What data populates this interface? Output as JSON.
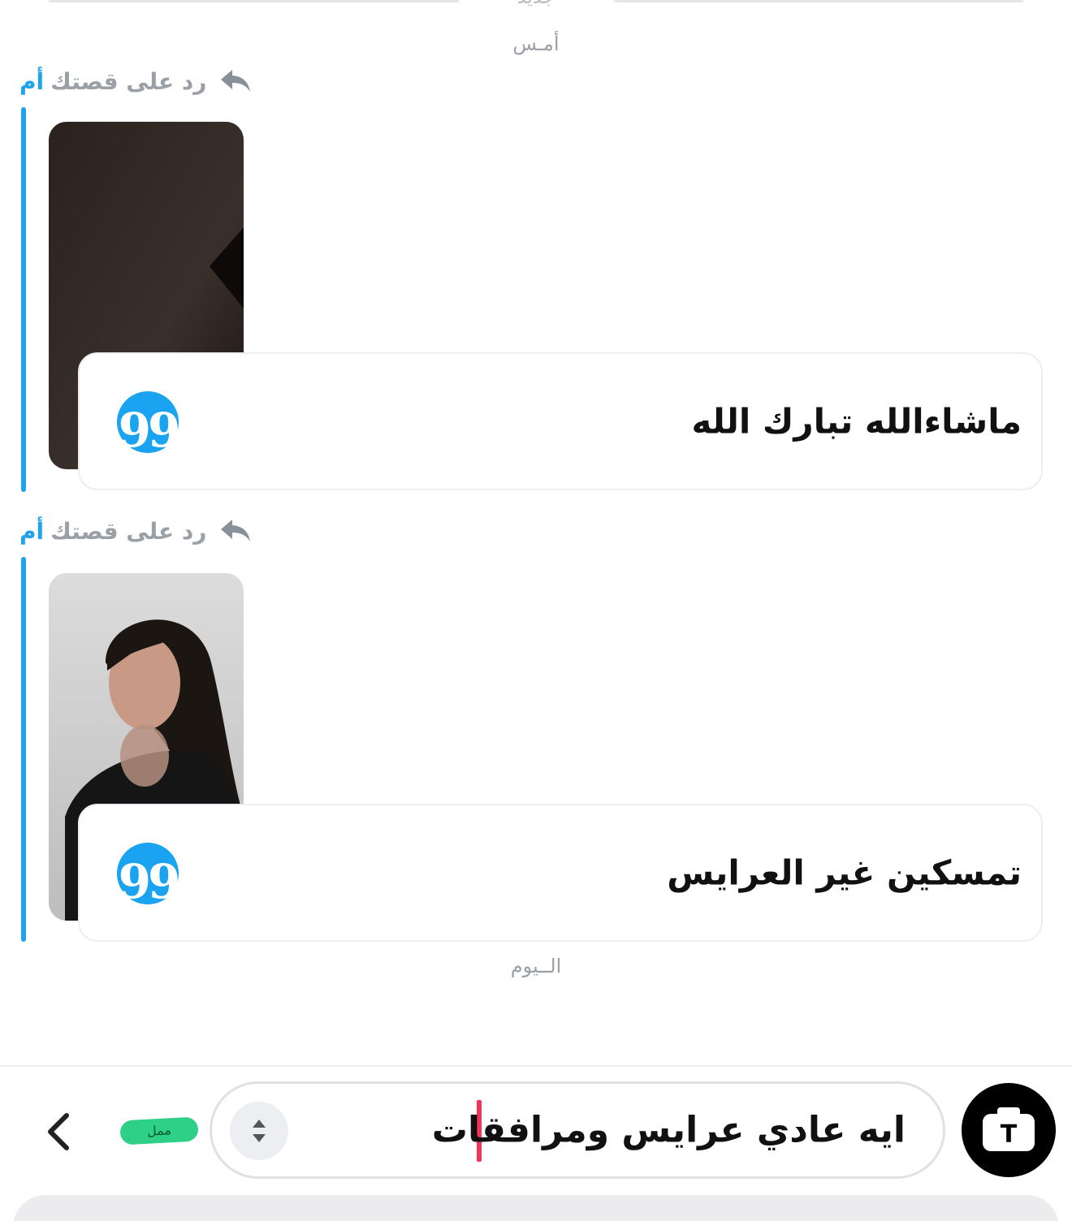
{
  "dividers": {
    "top_label": "جديد",
    "yesterday": "أمـس",
    "today": "الــيوم"
  },
  "messages": [
    {
      "reply_who": "أم",
      "reply_text": "رد على قصتك",
      "text": "ماشاءالله تبارك الله"
    },
    {
      "reply_who": "أم",
      "reply_text": "رد على قصتك",
      "text": "تمسكين غير العرايس"
    }
  ],
  "composer": {
    "input_value": "ايه عادي عرايس ومرافقات",
    "bitmoji_tag": "ممل",
    "camera_letter": "T"
  },
  "colors": {
    "accent": "#1fa3ec",
    "caret": "#f0355a",
    "tag": "#2ecf86"
  }
}
